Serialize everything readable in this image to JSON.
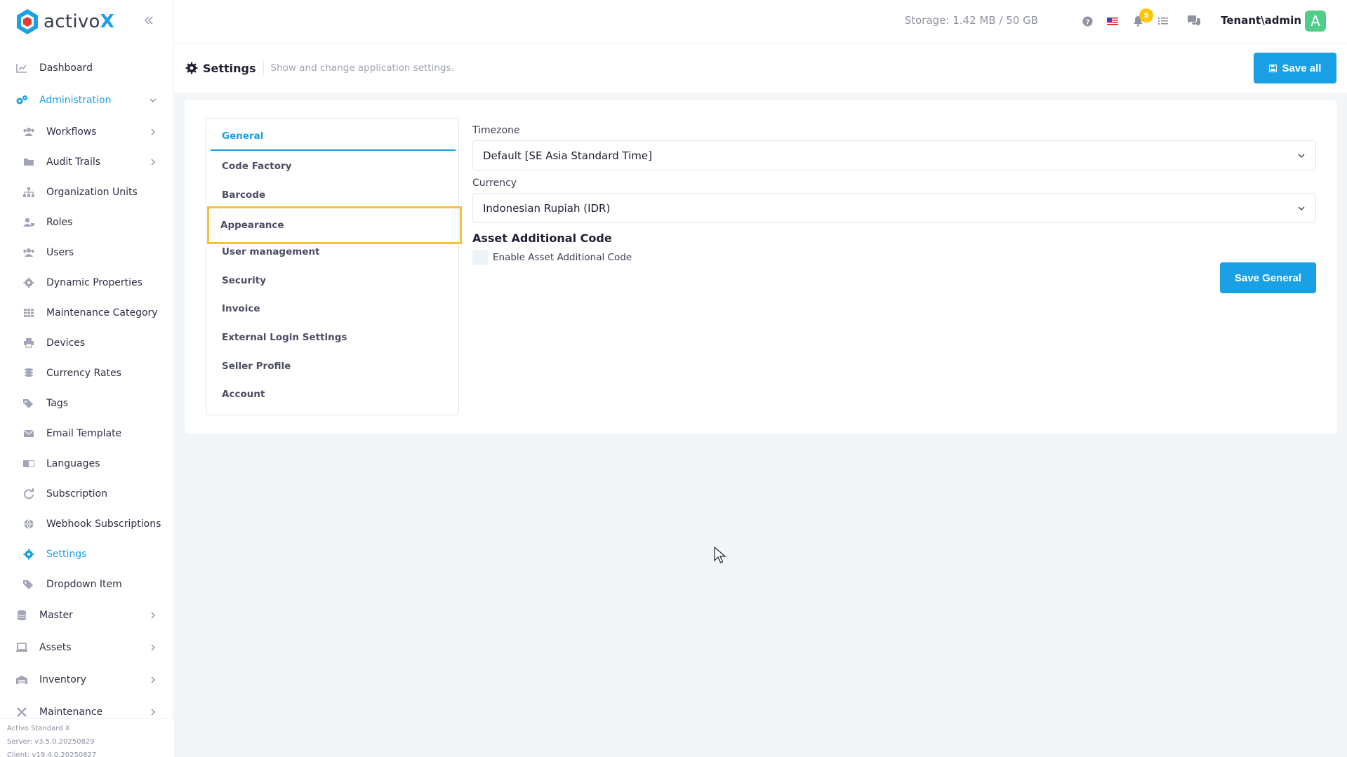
{
  "brand": {
    "name_prefix": "activo",
    "name_suffix": "X"
  },
  "sidebar": {
    "items": [
      {
        "label": "Dashboard",
        "icon": "chart-line-icon"
      },
      {
        "label": "Administration",
        "icon": "gears-icon",
        "active": true
      },
      {
        "label": "Workflows",
        "icon": "users-icon"
      },
      {
        "label": "Audit Trails",
        "icon": "folder-icon"
      },
      {
        "label": "Organization Units",
        "icon": "sitemap-icon"
      },
      {
        "label": "Roles",
        "icon": "user-tag-icon"
      },
      {
        "label": "Users",
        "icon": "users-icon"
      },
      {
        "label": "Dynamic Properties",
        "icon": "gear-icon"
      },
      {
        "label": "Maintenance Category",
        "icon": "grid-icon"
      },
      {
        "label": "Devices",
        "icon": "printer-icon"
      },
      {
        "label": "Currency Rates",
        "icon": "coins-icon"
      },
      {
        "label": "Tags",
        "icon": "tags-icon"
      },
      {
        "label": "Email Template",
        "icon": "envelope-icon"
      },
      {
        "label": "Languages",
        "icon": "language-icon"
      },
      {
        "label": "Subscription",
        "icon": "refresh-icon"
      },
      {
        "label": "Webhook Subscriptions",
        "icon": "globe-icon"
      },
      {
        "label": "Settings",
        "icon": "gear-icon",
        "active": true
      },
      {
        "label": "Dropdown Item",
        "icon": "tags-icon"
      },
      {
        "label": "Master",
        "icon": "database-icon"
      },
      {
        "label": "Assets",
        "icon": "laptop-icon"
      },
      {
        "label": "Inventory",
        "icon": "warehouse-icon"
      },
      {
        "label": "Maintenance",
        "icon": "tools-icon"
      }
    ],
    "footer": {
      "product": "Activo Standard X",
      "server": "Server: v3.5.0.20250829",
      "client": "Client: v19.4.0.20250827"
    }
  },
  "topbar": {
    "storage": "Storage: 1.42 MB / 50 GB",
    "notification_count": "5",
    "user": "Tenant\\admin",
    "avatar_letter": "A"
  },
  "subheader": {
    "title": "Settings",
    "description": "Show and change application settings.",
    "save_all_label": "Save all"
  },
  "tabs": [
    "General",
    "Code Factory",
    "Barcode",
    "Appearance",
    "User management",
    "Security",
    "Invoice",
    "External Login Settings",
    "Seller Profile",
    "Account"
  ],
  "form": {
    "timezone_label": "Timezone",
    "timezone_value": "Default [SE Asia Standard Time]",
    "currency_label": "Currency",
    "currency_value": "Indonesian Rupiah (IDR)",
    "asset_code_title": "Asset Additional Code",
    "asset_code_checkbox": "Enable Asset Additional Code",
    "save_general_label": "Save General"
  },
  "colors": {
    "accent": "#1aa1e5",
    "highlight": "#f6c23e",
    "badge": "#ffc700",
    "avatar": "#50cd89"
  }
}
